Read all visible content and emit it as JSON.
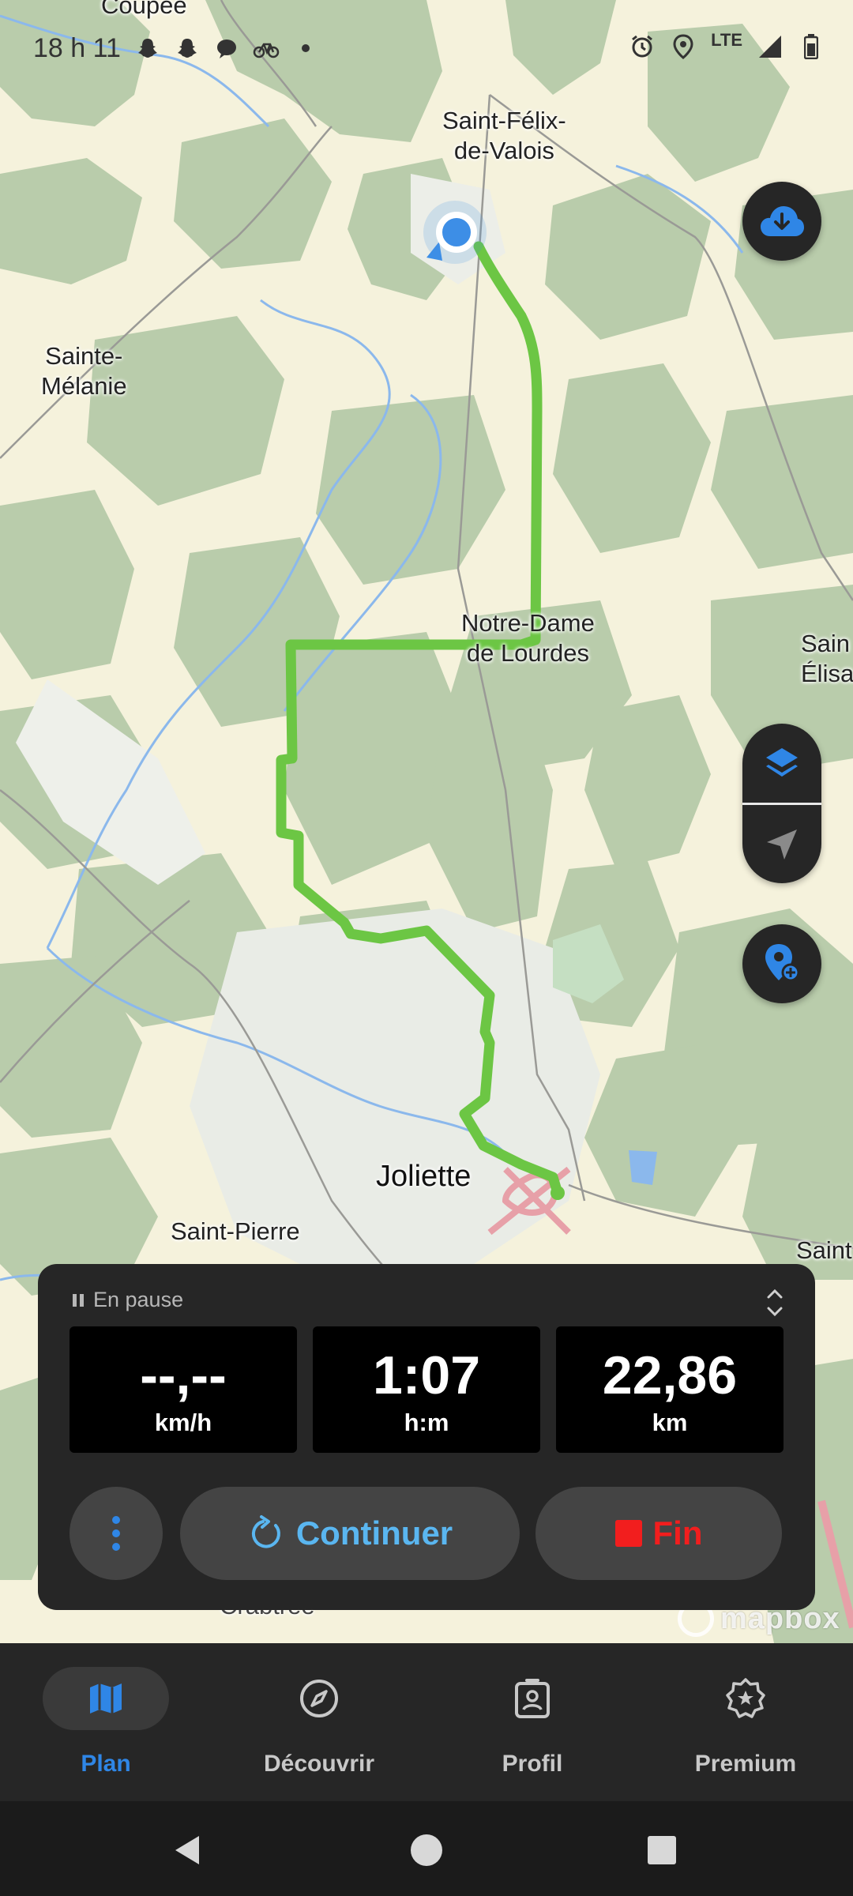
{
  "status_bar": {
    "time": "18 h 11",
    "network": "LTE",
    "icons_left": [
      "snapchat-icon",
      "snapchat-icon",
      "messenger-icon",
      "bike-icon",
      "dot-icon"
    ],
    "icons_right": [
      "alarm-icon",
      "location-icon",
      "signal-icon",
      "battery-icon"
    ]
  },
  "map": {
    "places": {
      "coupee": "Coupée",
      "saint_felix_l1": "Saint-Félix-",
      "saint_felix_l2": "de-Valois",
      "sainte_melanie_l1": "Sainte-",
      "sainte_melanie_l2": "Mélanie",
      "notre_dame_l1": "Notre-Dame",
      "notre_dame_l2": "de Lourdes",
      "sainte_elisa_l1": "Sain",
      "sainte_elisa_l2": "Élisa",
      "joliette": "Joliette",
      "saint_pierre": "Saint-Pierre",
      "saint_right": "Saint",
      "crabtree": "Crabtree"
    },
    "attribution": "mapbox",
    "route_color": "#6cc644",
    "location_color": "#3d8ee6"
  },
  "fabs": {
    "download": "cloud-download-icon",
    "layers": "layers-icon",
    "locate": "navigation-arrow-icon",
    "add_poi": "add-location-pin-icon"
  },
  "panel": {
    "status": "En pause",
    "speed": {
      "value": "--,--",
      "unit": "km/h"
    },
    "duration": {
      "value": "1:07",
      "unit": "h:m"
    },
    "distance": {
      "value": "22,86",
      "unit": "km"
    },
    "continue_label": "Continuer",
    "end_label": "Fin",
    "accent": "#5ab6f0",
    "danger": "#f21e1e"
  },
  "bottom_nav": {
    "items": [
      {
        "label": "Plan",
        "icon": "map-icon",
        "active": true
      },
      {
        "label": "Découvrir",
        "icon": "compass-icon",
        "active": false
      },
      {
        "label": "Profil",
        "icon": "profile-badge-icon",
        "active": false
      },
      {
        "label": "Premium",
        "icon": "premium-badge-icon",
        "active": false
      }
    ],
    "active_color": "#2f86e6"
  }
}
